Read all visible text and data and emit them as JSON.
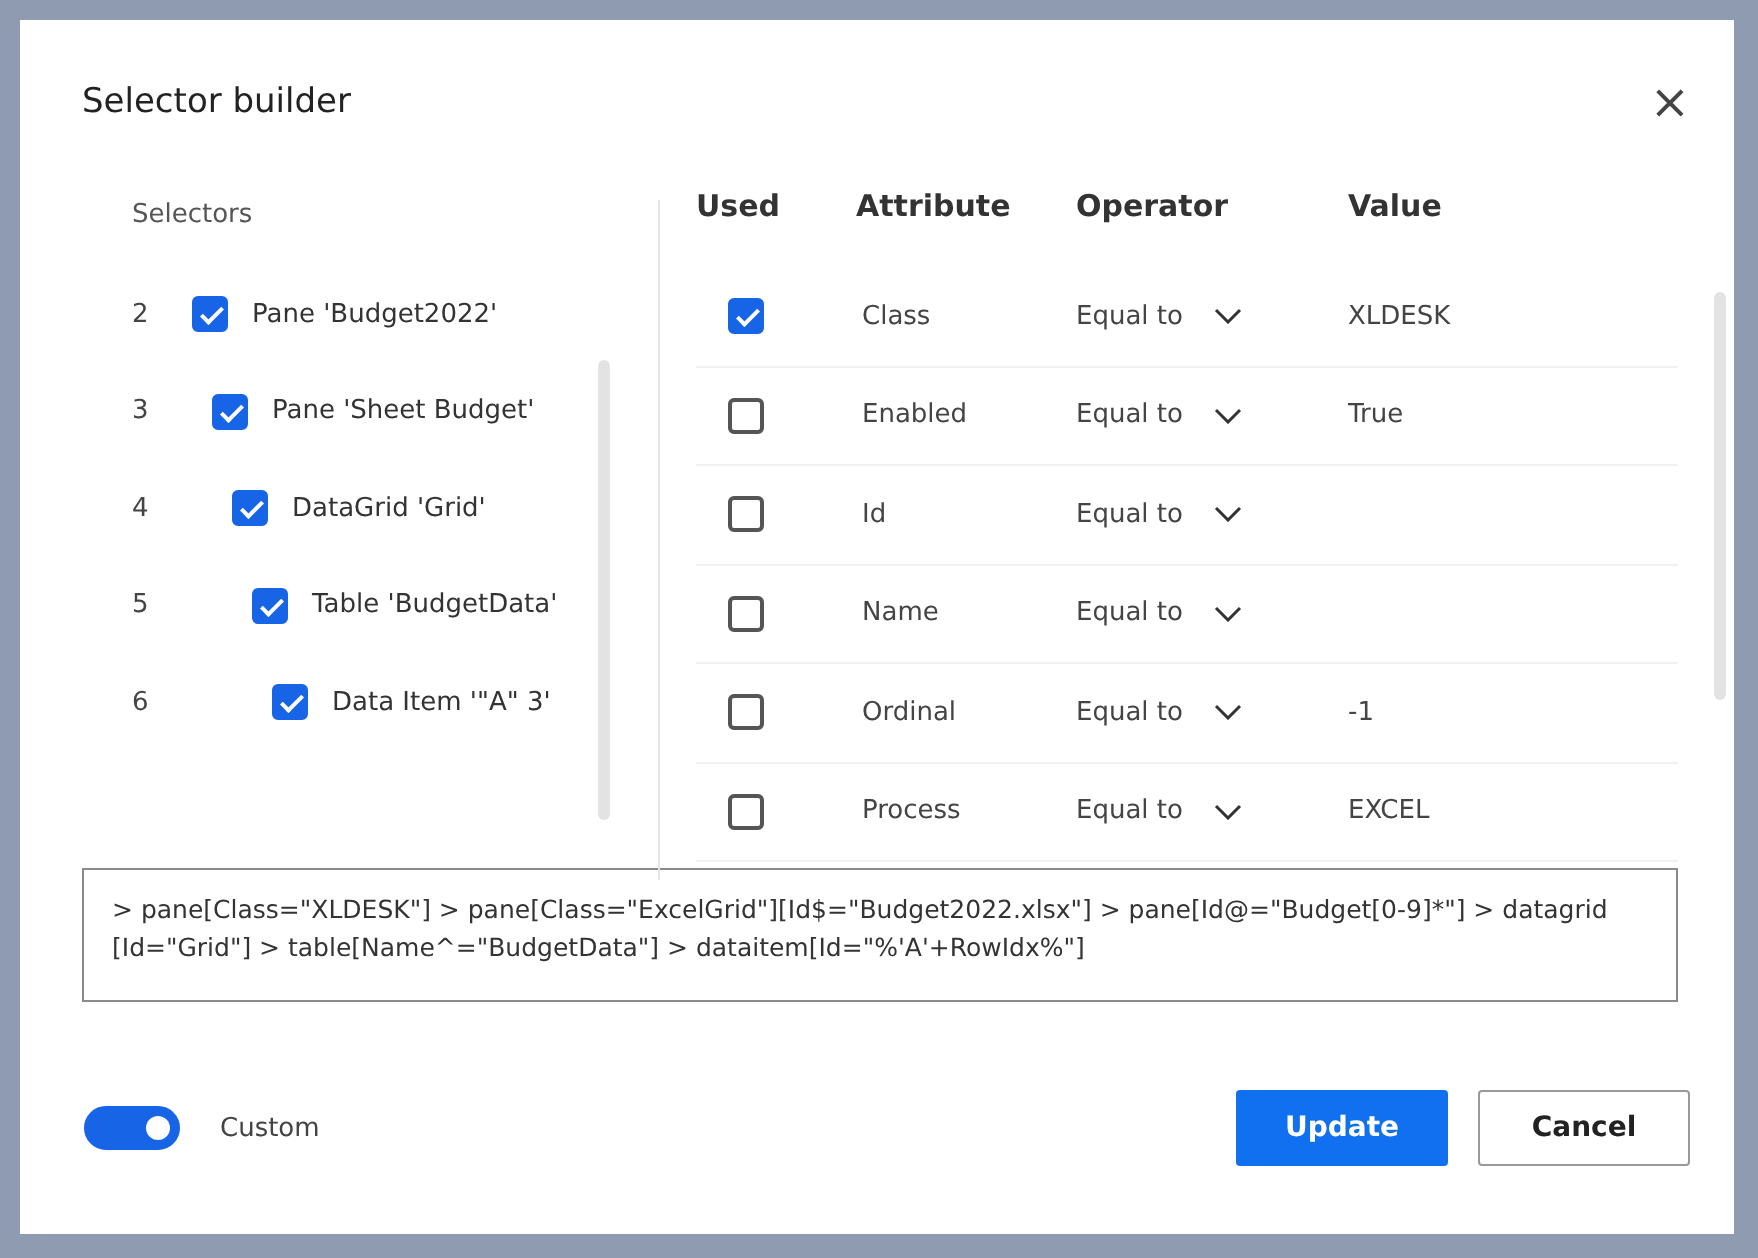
{
  "dialog": {
    "title": "Selector builder",
    "close": "×"
  },
  "selectors": {
    "heading": "Selectors",
    "items": [
      {
        "number": "2",
        "label": "Pane 'Budget2022'",
        "checked": true,
        "children": [
          {
            "number": "3",
            "label": "Pane 'Sheet Budget'",
            "checked": true,
            "children": [
              {
                "number": "4",
                "label": "DataGrid 'Grid'",
                "checked": true,
                "children": [
                  {
                    "number": "5",
                    "label": "Table 'BudgetData'",
                    "checked": true,
                    "children": [
                      {
                        "number": "6",
                        "label": "Data Item '\"A\" 3'",
                        "checked": true
                      }
                    ]
                  }
                ]
              }
            ]
          }
        ]
      }
    ]
  },
  "attributes": {
    "columns": [
      "Used",
      "Attribute",
      "Operator",
      "Value"
    ],
    "rows": [
      {
        "used": true,
        "attribute": "Class",
        "operator": "Equal to",
        "value": "XLDESK"
      },
      {
        "used": false,
        "attribute": "Enabled",
        "operator": "Equal to",
        "value": "True"
      },
      {
        "used": false,
        "attribute": "Id",
        "operator": "Equal to"
      },
      {
        "used": false,
        "attribute": "Name",
        "operator": "Equal to"
      },
      {
        "used": false,
        "attribute": "Ordinal",
        "operator": "Equal to",
        "value": "-1"
      },
      {
        "used": false,
        "attribute": "Process",
        "operator": "Equal to",
        "value": "EXCEL"
      }
    ]
  },
  "selector_text": "> pane[Class=\"XLDESK\"] > pane[Class=\"ExcelGrid\"][Id$=\"Budget2022.xlsx\"] > pane[Id@=\"Budget[0-9]*\"] > datagrid [Id=\"Grid\"] > table[Name^=\"BudgetData\"] > dataitem[Id=\"%'A'+RowIdx%\"]",
  "custom_toggle": {
    "label": "Custom",
    "on": true
  },
  "buttons": [
    {
      "label": "Update",
      "kind": "primary"
    },
    {
      "label": "Cancel",
      "kind": "secondary"
    }
  ]
}
